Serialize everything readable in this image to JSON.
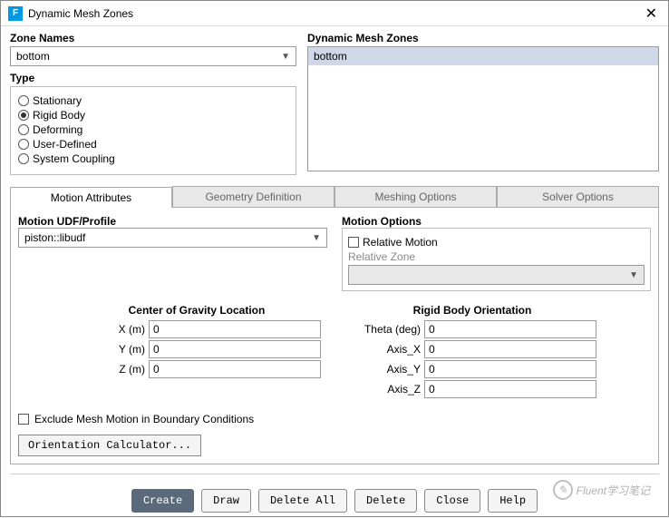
{
  "window": {
    "title": "Dynamic Mesh Zones"
  },
  "zoneNames": {
    "label": "Zone Names",
    "selected": "bottom"
  },
  "type": {
    "label": "Type",
    "options": [
      "Stationary",
      "Rigid Body",
      "Deforming",
      "User-Defined",
      "System Coupling"
    ],
    "selected": "Rigid Body"
  },
  "zonesList": {
    "label": "Dynamic Mesh Zones",
    "items": [
      "bottom"
    ]
  },
  "tabs": {
    "items": [
      "Motion Attributes",
      "Geometry Definition",
      "Meshing Options",
      "Solver Options"
    ],
    "active": 0
  },
  "motionUDF": {
    "label": "Motion UDF/Profile",
    "selected": "piston::libudf"
  },
  "motionOptions": {
    "label": "Motion Options",
    "relativeMotion": "Relative Motion",
    "relativeZone": "Relative Zone",
    "zoneSelected": ""
  },
  "cog": {
    "label": "Center of Gravity Location",
    "fields": [
      {
        "label": "X (m)",
        "value": "0"
      },
      {
        "label": "Y (m)",
        "value": "0"
      },
      {
        "label": "Z (m)",
        "value": "0"
      }
    ]
  },
  "orientation": {
    "label": "Rigid Body Orientation",
    "fields": [
      {
        "label": "Theta (deg)",
        "value": "0"
      },
      {
        "label": "Axis_X",
        "value": "0"
      },
      {
        "label": "Axis_Y",
        "value": "0"
      },
      {
        "label": "Axis_Z",
        "value": "0"
      }
    ]
  },
  "exclude": "Exclude Mesh Motion in Boundary Conditions",
  "orientCalc": "Orientation Calculator...",
  "buttons": {
    "create": "Create",
    "draw": "Draw",
    "deleteAll": "Delete All",
    "delete": "Delete",
    "close": "Close",
    "help": "Help"
  },
  "watermark": "Fluent学习笔记"
}
